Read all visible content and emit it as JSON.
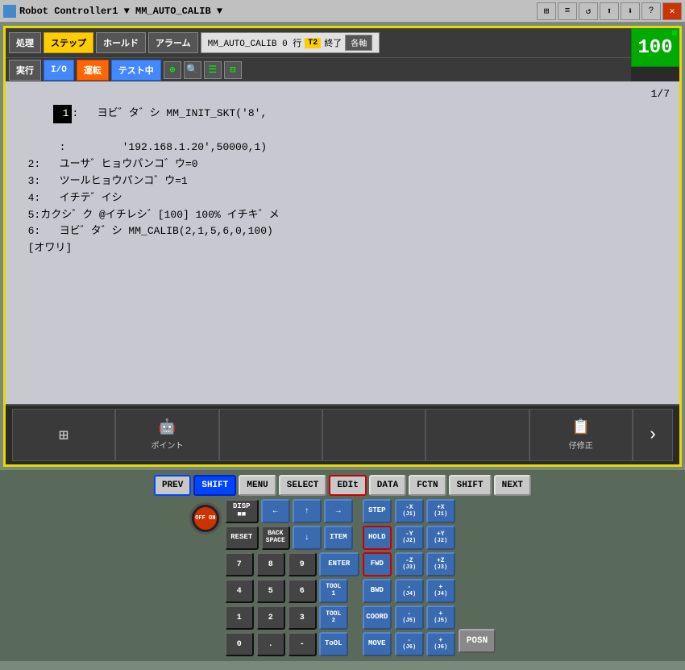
{
  "titlebar": {
    "controller": "Robot Controller1",
    "arrow": "▼",
    "program": "MM_AUTO_CALIB",
    "arrow2": "▼"
  },
  "toolbar": {
    "btn_shori": "処理",
    "btn_step": "ステップ",
    "btn_hold": "ホールド",
    "btn_alarm": "アラーム",
    "btn_jikko": "実行",
    "btn_io": "I/O",
    "btn_unten": "運転",
    "btn_test": "テスト中",
    "status_text": "MM_AUTO_CALIB 0 行",
    "status_t2": "T2",
    "status_end": "終了",
    "status_kakujiku": "各軸",
    "value": "100"
  },
  "program": {
    "name": "MM_AUTO_CALIB",
    "page": "1/7",
    "lines": [
      {
        "num": "1",
        "highlight": true,
        "text": "  ヨビ゛タ゛シ MM_INIT_SKT('8',"
      },
      {
        "num": " ",
        "highlight": false,
        "text": "        '192.168.1.20',50000,1)"
      },
      {
        "num": "2",
        "highlight": false,
        "text": "  ユーザ゛ヒョウバ゛ンコ゛ウ=0"
      },
      {
        "num": "3",
        "highlight": false,
        "text": "  ツールヒョウバ゛ンコ゛ウ=1"
      },
      {
        "num": "4",
        "highlight": false,
        "text": "  イチテ゛イシ"
      },
      {
        "num": "5",
        "highlight": false,
        "text": ":カクシ゛ク @イチレシ゛[100] 100% イチキ゛メ"
      },
      {
        "num": "6",
        "highlight": false,
        "text": "  ヨビ゛タ゛シ MM_CALIB(2,1,5,6,0,100)"
      }
    ],
    "footer": "[オワリ]"
  },
  "fn_buttons": [
    {
      "id": "grid",
      "icon": "⊞",
      "label": ""
    },
    {
      "id": "robot",
      "icon": "🤖",
      "label": "ポイント"
    },
    {
      "id": "empty1",
      "icon": "",
      "label": ""
    },
    {
      "id": "empty2",
      "icon": "",
      "label": ""
    },
    {
      "id": "empty3",
      "icon": "",
      "label": ""
    },
    {
      "id": "correction",
      "icon": "📋",
      "label": "仔修正"
    }
  ],
  "fn_next": "›",
  "keyboard": {
    "fkeys": [
      {
        "id": "prev",
        "label": "PREV",
        "style": "normal"
      },
      {
        "id": "shift",
        "label": "SHIFT",
        "style": "active-blue"
      },
      {
        "id": "menu",
        "label": "MENU",
        "style": "normal"
      },
      {
        "id": "select",
        "label": "SELECT",
        "style": "normal"
      },
      {
        "id": "edit",
        "label": "EDIt",
        "style": "red-outline"
      },
      {
        "id": "data",
        "label": "DATA",
        "style": "normal"
      },
      {
        "id": "fctn",
        "label": "FCTN",
        "style": "normal"
      },
      {
        "id": "shift2",
        "label": "SHIFT",
        "style": "normal"
      },
      {
        "id": "next",
        "label": "NEXT",
        "style": "normal"
      }
    ],
    "row1": [
      {
        "id": "disp",
        "label": "DISP\n■■",
        "style": "dark"
      },
      {
        "id": "back_left",
        "label": "←",
        "style": "blue"
      },
      {
        "id": "up",
        "label": "↑",
        "style": "blue"
      },
      {
        "id": "right",
        "label": "→",
        "style": "blue"
      },
      {
        "id": "step",
        "label": "STEP",
        "style": "blue"
      },
      {
        "id": "j1_neg",
        "label": "-X\n(J1)",
        "style": "blue"
      },
      {
        "id": "j1_pos",
        "label": "+X\n(J1)",
        "style": "blue"
      }
    ],
    "row2": [
      {
        "id": "reset",
        "label": "RESET",
        "style": "dark"
      },
      {
        "id": "backspace",
        "label": "BACK\nSPACE",
        "style": "dark"
      },
      {
        "id": "down",
        "label": "↓",
        "style": "blue"
      },
      {
        "id": "item",
        "label": "ITEM",
        "style": "blue"
      },
      {
        "id": "hold",
        "label": "HOLD",
        "style": "blue"
      },
      {
        "id": "j2_neg",
        "label": "-Y\n(J2)",
        "style": "blue"
      },
      {
        "id": "j2_pos",
        "label": "+Y\n(J2)",
        "style": "blue"
      }
    ],
    "row3": [
      {
        "id": "num7",
        "label": "7",
        "style": "dark"
      },
      {
        "id": "num8",
        "label": "8",
        "style": "dark"
      },
      {
        "id": "num9",
        "label": "9",
        "style": "dark"
      },
      {
        "id": "enter",
        "label": "ENTER",
        "style": "blue"
      },
      {
        "id": "fwd",
        "label": "FWD",
        "style": "red-outline-blue"
      },
      {
        "id": "j3_neg",
        "label": "-Z\n(J3)",
        "style": "blue"
      },
      {
        "id": "j3_pos",
        "label": "+Z\n(J3)",
        "style": "blue"
      }
    ],
    "row4": [
      {
        "id": "num4",
        "label": "4",
        "style": "dark"
      },
      {
        "id": "num5",
        "label": "5",
        "style": "dark"
      },
      {
        "id": "num6",
        "label": "6",
        "style": "dark"
      },
      {
        "id": "tool1",
        "label": "TOOL\n1",
        "style": "blue"
      },
      {
        "id": "bwd",
        "label": "BWD",
        "style": "blue"
      },
      {
        "id": "j4_neg",
        "label": "-\n(J4)",
        "style": "blue"
      },
      {
        "id": "j4_pos",
        "label": "+\n(J4)",
        "style": "blue"
      }
    ],
    "row5": [
      {
        "id": "num1",
        "label": "1",
        "style": "dark"
      },
      {
        "id": "num2",
        "label": "2",
        "style": "dark"
      },
      {
        "id": "num3",
        "label": "3",
        "style": "dark"
      },
      {
        "id": "tool2",
        "label": "TOOL\n2",
        "style": "blue"
      },
      {
        "id": "coord",
        "label": "COORD",
        "style": "blue"
      },
      {
        "id": "j5_neg",
        "label": "-\n(J5)",
        "style": "blue"
      },
      {
        "id": "j5_pos",
        "label": "+\n(J5)",
        "style": "blue"
      }
    ],
    "row6": [
      {
        "id": "num0",
        "label": "0",
        "style": "dark"
      },
      {
        "id": "dot",
        "label": ".",
        "style": "dark"
      },
      {
        "id": "minus",
        "label": "-",
        "style": "dark"
      },
      {
        "id": "tool_label",
        "label": "ToOL",
        "style": "blue"
      },
      {
        "id": "move",
        "label": "MOVE",
        "style": "blue"
      },
      {
        "id": "j6_neg",
        "label": "-\n(J6)",
        "style": "blue"
      },
      {
        "id": "j6_pos",
        "label": "+\n(J6)",
        "style": "blue"
      }
    ]
  }
}
